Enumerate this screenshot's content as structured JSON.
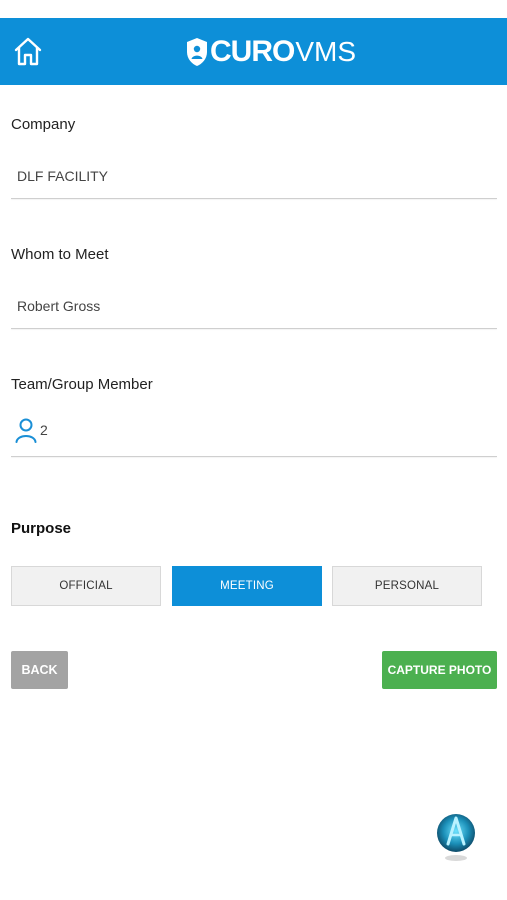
{
  "header": {
    "brand": "CURO",
    "product": "VMS",
    "background_color": "#0d8fd8",
    "home_icon": "home-icon"
  },
  "form": {
    "company": {
      "label": "Company",
      "value": "DLF FACILITY"
    },
    "whom_to_meet": {
      "label": "Whom to Meet",
      "value": "Robert Gross"
    },
    "team": {
      "label": "Team/Group Member",
      "value": "2",
      "icon": "person-icon"
    },
    "purpose": {
      "label": "Purpose",
      "options": [
        "OFFICIAL",
        "MEETING",
        "PERSONAL"
      ],
      "selected": "MEETING"
    }
  },
  "actions": {
    "back_label": "BACK",
    "capture_label": "CAPTURE PHOTO",
    "back_color": "#a3a3a3",
    "capture_color": "#4cb050"
  },
  "floating": {
    "icon": "assistant-icon"
  }
}
